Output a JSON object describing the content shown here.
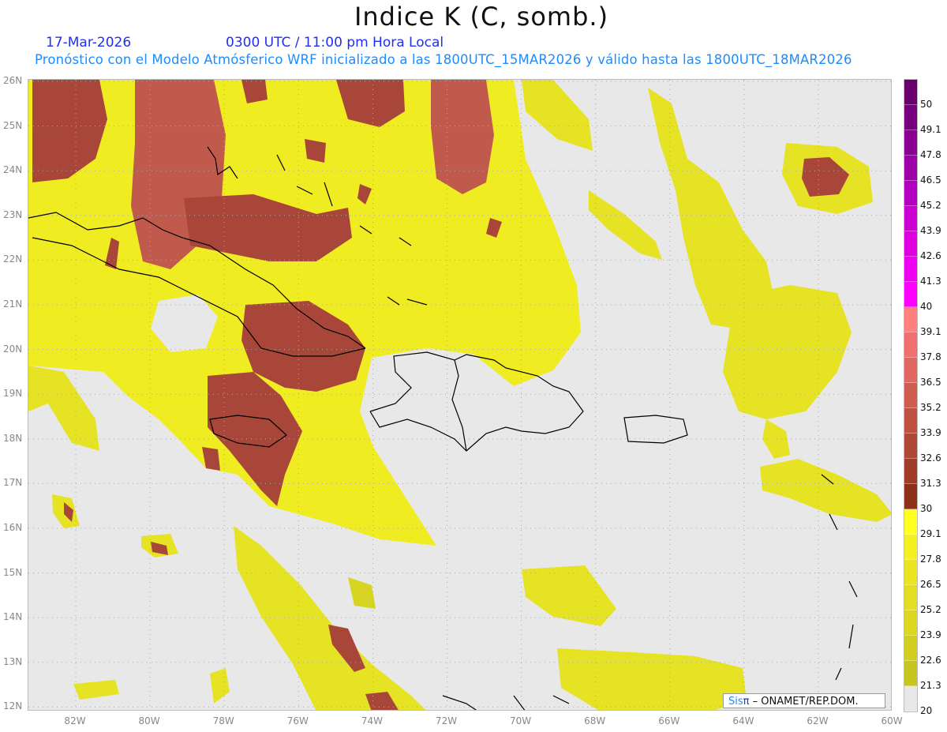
{
  "title": "Indice K (C, somb.)",
  "date": "17-Mar-2026",
  "time": "0300 UTC / 11:00 pm Hora Local",
  "subtitle": "Pronóstico con el Modelo Atmósferico WRF inicializado a las 1800UTC_15MAR2026 y válido hasta las  1800UTC_18MAR2026",
  "credit": {
    "sis": "Sis",
    "pi": "π",
    "rest": " – ONAMET/REP.DOM."
  },
  "lat_labels": [
    "26N",
    "25N",
    "24N",
    "23N",
    "22N",
    "21N",
    "20N",
    "19N",
    "18N",
    "17N",
    "16N",
    "15N",
    "14N",
    "13N",
    "12N"
  ],
  "lon_labels": [
    "82W",
    "80W",
    "78W",
    "76W",
    "74W",
    "72W",
    "70W",
    "68W",
    "66W",
    "64W",
    "62W",
    "60W"
  ],
  "colorbar": {
    "labels": [
      "50",
      "49.1",
      "47.8",
      "46.5",
      "45.2",
      "43.9",
      "42.6",
      "41.3",
      "40",
      "39.1",
      "37.8",
      "36.5",
      "35.2",
      "33.9",
      "32.6",
      "31.3",
      "30",
      "29.1",
      "27.8",
      "26.5",
      "25.2",
      "23.9",
      "22.6",
      "21.3",
      "20"
    ],
    "colors": [
      "#6a0070",
      "#78007e",
      "#8a0090",
      "#9c00a6",
      "#b400c0",
      "#cc00d0",
      "#e000e0",
      "#f000f0",
      "#ff00ff",
      "#ff8080",
      "#f07070",
      "#e06860",
      "#d05c50",
      "#c05040",
      "#b04838",
      "#a03c28",
      "#8c3018",
      "#ffff20",
      "#f5f020",
      "#ebe520",
      "#e2de20",
      "#dcd820",
      "#d2ce20",
      "#c8c420",
      "#e8e8e8"
    ]
  }
}
